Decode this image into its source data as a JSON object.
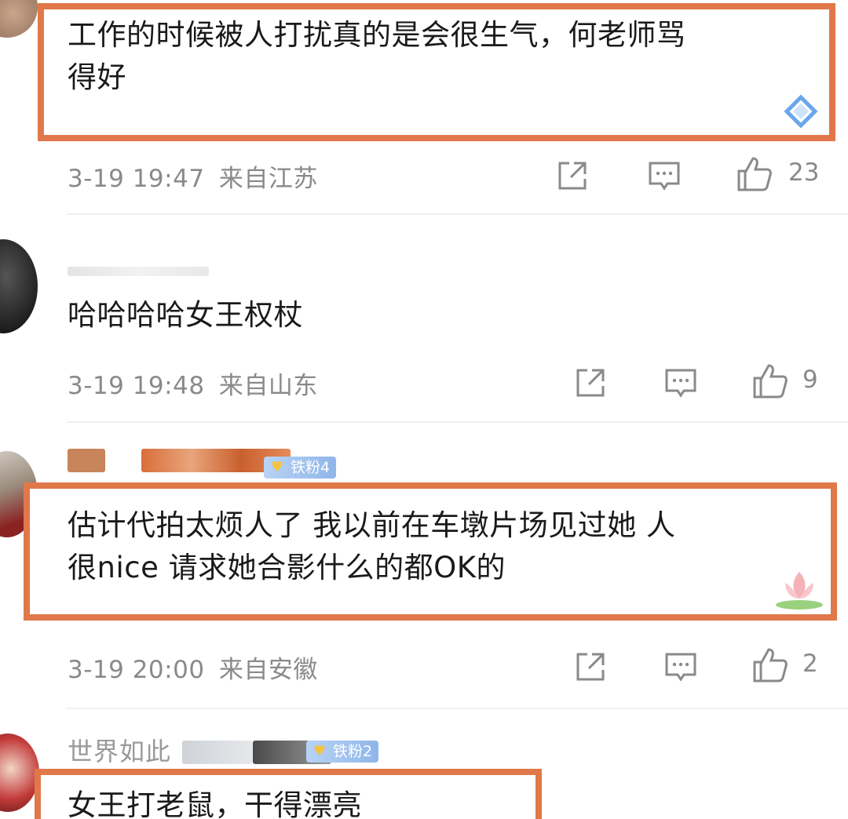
{
  "comments": [
    {
      "text_line1": "工作的时候被人打扰真的是会很生气，何老师骂",
      "text_line2": "得好",
      "date": "3-19 19:47",
      "location": "来自江苏",
      "likes": "23",
      "highlighted": true
    },
    {
      "text_line1": "哈哈哈哈女王权杖",
      "date": "3-19 19:48",
      "location": "来自山东",
      "likes": "9",
      "highlighted": false
    },
    {
      "fan_badge": "铁粉4",
      "text_line1": "估计代拍太烦人了 我以前在车墩片场见过她 人",
      "text_line2": "很nice 请求她合影什么的都OK的",
      "date": "3-19 20:00",
      "location": "来自安徽",
      "likes": "2",
      "highlighted": true
    },
    {
      "username_partial": "世界如此",
      "fan_badge": "铁粉2",
      "text_line1": "女王打老鼠，干得漂亮",
      "highlighted": true
    }
  ],
  "icons": {
    "share": "share-icon",
    "comment": "comment-icon",
    "like": "thumbs-up-icon"
  },
  "colors": {
    "highlight_border": "#e0784a",
    "meta_text": "#8a8a8a",
    "fan_badge": "#8fb6ea"
  }
}
